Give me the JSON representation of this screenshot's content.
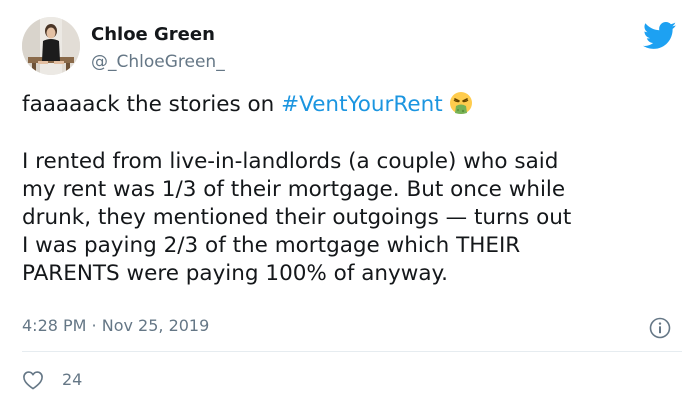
{
  "author": {
    "display_name": "Chloe Green",
    "handle": "@_ChloeGreen_"
  },
  "tweet": {
    "first_line_text": "faaaaack the stories on ",
    "hashtag": "#VentYourRent",
    "emoji": "face-vomiting-emoji",
    "body_lines": [
      "I rented from live-in-landlords (a couple) who said",
      "my rent was 1/3 of their mortgage. But once while",
      "drunk, they mentioned their outgoings — turns out",
      "I was paying 2/3 of the mortgage which THEIR",
      "PARENTS were paying 100% of anyway."
    ]
  },
  "meta": {
    "timestamp": "4:28 PM · Nov 25, 2019"
  },
  "engagement": {
    "like_count": "24"
  },
  "icons": {
    "brand": "twitter-bird-icon",
    "info": "info-icon",
    "like": "heart-icon"
  },
  "colors": {
    "hashtag": "#1b95e0",
    "twitter_blue": "#1da1f2",
    "secondary_text": "#657786",
    "primary_text": "#14171a",
    "divider": "#e6ecf0"
  }
}
